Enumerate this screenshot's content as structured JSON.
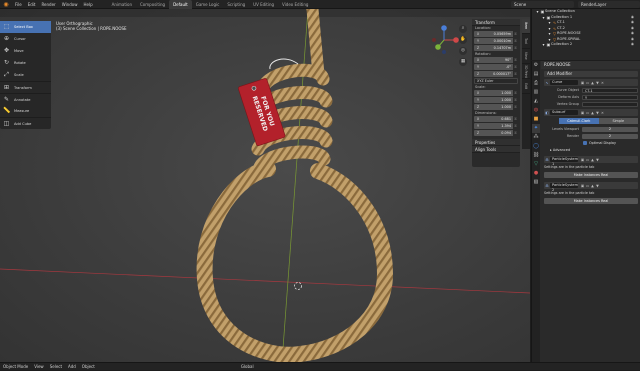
{
  "topbar": {
    "menus": [
      "File",
      "Edit",
      "Render",
      "Window",
      "Help"
    ],
    "workspaces": [
      "Animation",
      "Compositing",
      "Default",
      "Game Logic",
      "Scripting",
      "UV Editing",
      "Video Editing"
    ],
    "active_workspace": "Default",
    "scene": "Scene",
    "view_layer": "RenderLayer"
  },
  "toolbar": {
    "tools": [
      {
        "label": "Select Box",
        "icon": "select-box-icon",
        "glyph": "⬚"
      },
      {
        "label": "Cursor",
        "icon": "cursor-icon",
        "glyph": "⊕"
      },
      {
        "label": "Move",
        "icon": "move-icon",
        "glyph": "✥"
      },
      {
        "label": "Rotate",
        "icon": "rotate-icon",
        "glyph": "↻"
      },
      {
        "label": "Scale",
        "icon": "scale-icon",
        "glyph": "⤢"
      },
      {
        "label": "Transform",
        "icon": "transform-icon",
        "glyph": "⊞"
      },
      {
        "label": "Annotate",
        "icon": "annotate-icon",
        "glyph": "✎"
      },
      {
        "label": "Measure",
        "icon": "measure-icon",
        "glyph": "📏"
      },
      {
        "label": "Add Cube",
        "icon": "add-cube-icon",
        "glyph": "◫"
      }
    ]
  },
  "viewport": {
    "info_line1": "User Orthographic",
    "info_line2": "(3) Scene Collection | ROPE.NOOSE",
    "tag_text": "RESERVED\nFOR YOU",
    "colors": {
      "rope": "#c2a06a",
      "rope_dark": "#8a6a3c",
      "tag": "#b3212b",
      "bg": "#3d3d3d",
      "axis_x": "#a8383f",
      "axis_y": "#7a9a33"
    }
  },
  "npanel": {
    "title": "Transform",
    "location_label": "Location:",
    "location": [
      {
        "ax": "X",
        "v": "0.05659m"
      },
      {
        "ax": "Y",
        "v": "0.00010m"
      },
      {
        "ax": "Z",
        "v": "0.14707m"
      }
    ],
    "rotation_label": "Rotation:",
    "rotation": [
      {
        "ax": "X",
        "v": "90°"
      },
      {
        "ax": "Y",
        "v": "-0°"
      },
      {
        "ax": "Z",
        "v": "0.000017°"
      }
    ],
    "rotation_mode": "XYZ Euler",
    "scale_label": "Scale:",
    "scale": [
      {
        "ax": "X",
        "v": "1.000"
      },
      {
        "ax": "Y",
        "v": "1.000"
      },
      {
        "ax": "Z",
        "v": "1.000"
      }
    ],
    "dimensions_label": "Dimensions:",
    "dimensions": [
      {
        "ax": "X",
        "v": "0.681"
      },
      {
        "ax": "Y",
        "v": "1.394"
      },
      {
        "ax": "Z",
        "v": "0.094"
      }
    ],
    "properties": "Properties",
    "align_tools": "Align Tools",
    "tabs": [
      "Item",
      "Tool",
      "View",
      "3D Print",
      "Edit"
    ]
  },
  "footer": {
    "mode": "Object Mode",
    "items": [
      "View",
      "Select",
      "Add",
      "Object"
    ],
    "global": "Global"
  },
  "outliner": {
    "rows": [
      {
        "label": "Scene Collection",
        "indent": 0,
        "icon": "collection-icon",
        "glyph": "▣",
        "color": "#ddd"
      },
      {
        "label": "Collection 1",
        "indent": 1,
        "icon": "collection-icon",
        "glyph": "▣",
        "color": "#ddd"
      },
      {
        "label": "CT-1",
        "indent": 2,
        "icon": "curve-icon",
        "glyph": "∿",
        "color": "#ee8a2a"
      },
      {
        "label": "CT-2",
        "indent": 2,
        "icon": "curve-icon",
        "glyph": "∿",
        "color": "#ee8a2a"
      },
      {
        "label": "ROPE.NOOSE",
        "indent": 2,
        "icon": "mesh-icon",
        "glyph": "▽",
        "color": "#ee8a2a"
      },
      {
        "label": "ROPE.SPIRAL",
        "indent": 2,
        "icon": "mesh-icon",
        "glyph": "▽",
        "color": "#ee8a2a"
      },
      {
        "label": "Collection 2",
        "indent": 1,
        "icon": "collection-icon",
        "glyph": "▣",
        "color": "#ddd"
      }
    ]
  },
  "properties": {
    "object_name": "ROPE.NOOSE",
    "add_modifier": "Add Modifier",
    "curve_mod": {
      "name": "Curve",
      "curve_object_label": "Curve Object",
      "curve_object": "CT-1",
      "deform_axis_label": "Deform Axis",
      "deform_axis": "Y",
      "vertex_group_label": "Vertex Group"
    },
    "subsurf_mod": {
      "name": "Subsurf",
      "seg_on": "Catmull-Clark",
      "seg_off": "Simple",
      "levels_label": "Levels Viewport",
      "levels": "2",
      "render_label": "Render",
      "render": "2",
      "optimal": "Optimal Display",
      "advanced": "Advanced"
    },
    "ps1": {
      "name": "ParticleSystem 1",
      "note": "Settings are in the particle tab",
      "button": "Make Instances Real"
    },
    "ps2": {
      "name": "ParticleSystem 2",
      "note": "Settings are in the particle tab",
      "button": "Make Instances Real"
    }
  }
}
